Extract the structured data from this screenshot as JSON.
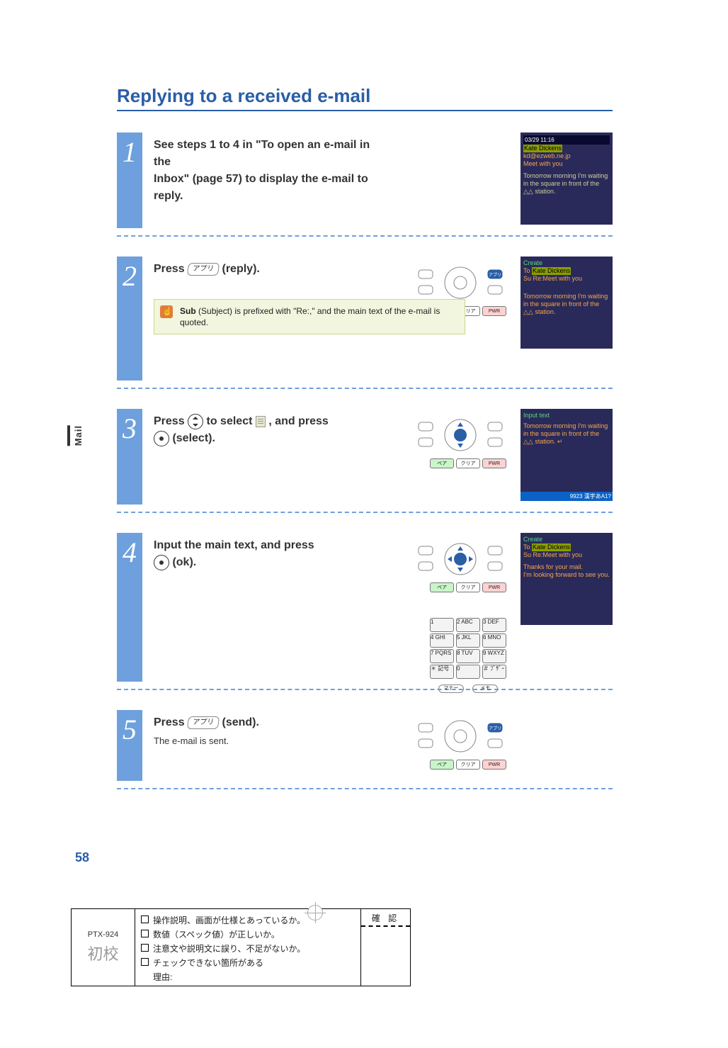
{
  "side_tab": "Mail",
  "page_number": "58",
  "title": "Replying to a received e-mail",
  "steps": [
    {
      "num": "1",
      "instruction_a": "See steps 1 to 4 in \"To open an e-mail in the",
      "instruction_b": "Inbox\" (page 57) to display the e-mail to reply.",
      "screen": {
        "time": "03/29 11:16",
        "from_label": "Kate Dickens",
        "addr": "kd@ezweb.ne.jp",
        "subj": "Meet with you",
        "body": "Tomorrow morning I'm waiting in the square in front of the △△ station."
      }
    },
    {
      "num": "2",
      "instr_prefix": "Press ",
      "key_label": "アプリ",
      "instr_suffix": " (reply).",
      "note_sub": "Sub",
      "note_text": "(Subject) is prefixed with \"Re:,\" and the main text of the e-mail is quoted.",
      "screen": {
        "hdr": "Create",
        "to": "Kate Dickens",
        "su": "Re:Meet with you",
        "body": "Tomorrow morning I'm waiting in the square in front of the △△ station."
      }
    },
    {
      "num": "3",
      "instr_a": "Press ",
      "instr_b": " to select ",
      "instr_c": ", and press",
      "instr_d": " (select).",
      "screen": {
        "hdr": "Input text",
        "body": "Tomorrow morning I'm waiting in the square in front of the △△ station. ↵",
        "footer": "9923 漢字あA1?"
      }
    },
    {
      "num": "4",
      "instr_a": "Input the main text, and press",
      "instr_b": " (ok).",
      "screen": {
        "hdr": "Create",
        "to": "Kate Dickens",
        "su": "Re:Meet with you",
        "body1": "Thanks for your mail.",
        "body2": "I'm looking forward to see you."
      },
      "numpad": {
        "rows": [
          [
            "1",
            "2 ABC",
            "3 DEF"
          ],
          [
            "4 GHI",
            "5 JKL",
            "6 MNO"
          ],
          [
            "7 PQRS",
            "8 TUV",
            "9 WXYZ"
          ],
          [
            "＊ 記号",
            "0",
            "＃ ﾌﾞｻﾞｰ"
          ]
        ],
        "pills": [
          "マナー",
          "メモ"
        ]
      }
    },
    {
      "num": "5",
      "instr_prefix": "Press ",
      "key_label": "アプリ",
      "instr_suffix": " (send).",
      "subtext": "The e-mail is sent."
    }
  ],
  "keycluster": {
    "left": "ペア",
    "mid": "クリア",
    "right": "PWR"
  },
  "nav_side": {
    "tl": "",
    "bl": "",
    "tr": "アプリ",
    "br": ""
  },
  "proof": {
    "model": "PTX-924",
    "stage": "初校",
    "lines": [
      "操作説明、画面が仕様とあっているか。",
      "数値（スペック値）が正しいか。",
      "注意文や説明文に誤り、不足がないか。",
      "チェックできない箇所がある"
    ],
    "reason_label": "理由:",
    "confirm": "確 認"
  }
}
